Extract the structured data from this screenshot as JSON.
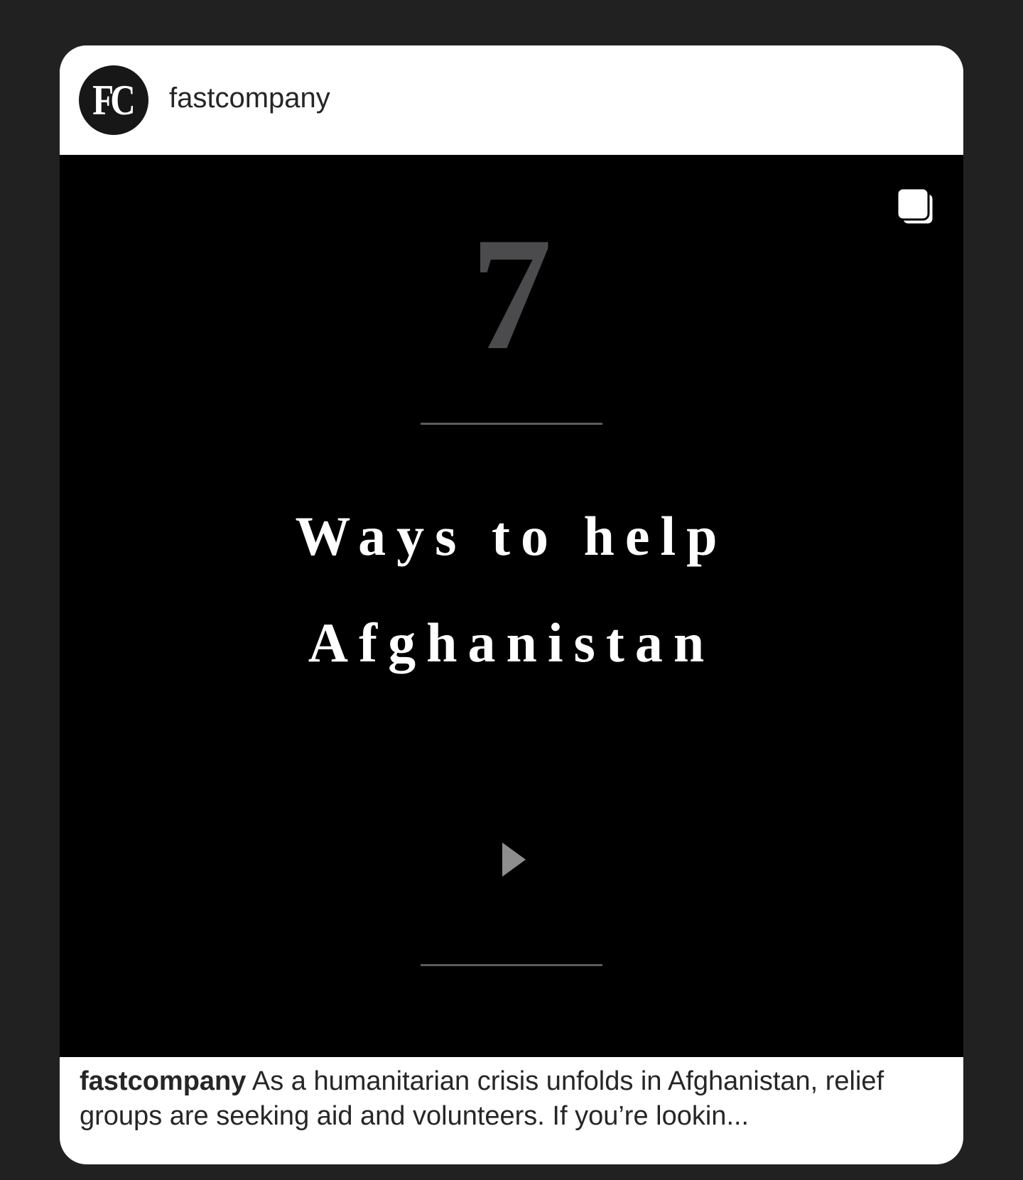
{
  "post": {
    "avatar_text": "FC",
    "username": "fastcompany",
    "media": {
      "number": "7",
      "headline_line1": "Ways to help",
      "headline_line2": "Afghanistan",
      "icons": {
        "carousel": "multiple-images-icon",
        "play": "play-arrow-icon"
      }
    },
    "caption": {
      "username": "fastcompany",
      "text": "As a humanitarian crisis unfolds in Afghanistan, relief groups are seeking aid and volunteers. If you’re lookin..."
    }
  },
  "colors": {
    "page_background": "#212121",
    "card_background": "#ffffff",
    "media_background": "#000000",
    "number_color": "#4b4b4d",
    "headline_color": "#ffffff"
  }
}
